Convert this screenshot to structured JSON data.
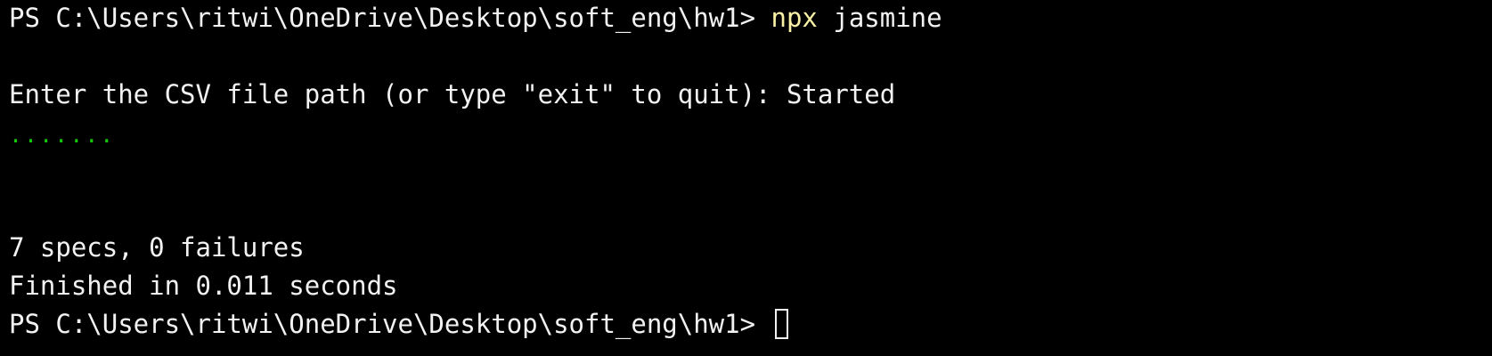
{
  "colors": {
    "background": "#000000",
    "text": "#f2f2f2",
    "command": "#f9f1a5",
    "progress": "#16c60c"
  },
  "terminal": {
    "prompt1": "PS C:\\Users\\ritwi\\OneDrive\\Desktop\\soft_eng\\hw1> ",
    "command_exe": "npx",
    "command_args": " jasmine",
    "input_prompt": "Enter the CSV file path (or type \"exit\" to quit): Started",
    "progress_dots": ".......",
    "summary": "7 specs, 0 failures",
    "finished": "Finished in 0.011 seconds",
    "prompt2": "PS C:\\Users\\ritwi\\OneDrive\\Desktop\\soft_eng\\hw1> "
  }
}
